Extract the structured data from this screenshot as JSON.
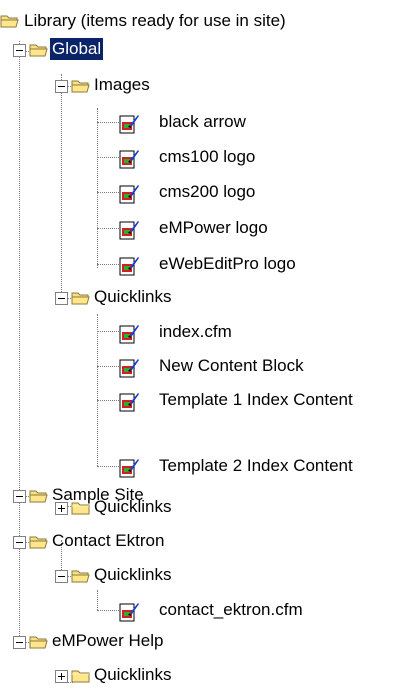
{
  "tree": {
    "root": {
      "label": "Library (items ready for use in site)",
      "icon": "open-folder-icon"
    },
    "global": {
      "label": "Global",
      "selected": true,
      "images": {
        "label": "Images",
        "items": [
          {
            "label": "black arrow",
            "icon": "content-item-icon"
          },
          {
            "label": "cms100 logo",
            "icon": "content-item-icon"
          },
          {
            "label": "cms200 logo",
            "icon": "content-item-icon"
          },
          {
            "label": "eMPower logo",
            "icon": "content-item-icon"
          },
          {
            "label": "eWebEditPro logo",
            "icon": "content-item-icon"
          }
        ]
      },
      "quicklinks": {
        "label": "Quicklinks",
        "items": [
          {
            "label": "index.cfm",
            "icon": "content-item-icon"
          },
          {
            "label": "New Content Block",
            "icon": "content-item-icon"
          },
          {
            "label": "Template 1 Index Content",
            "icon": "content-item-icon"
          },
          {
            "label": "Template 2 Index Content",
            "icon": "content-item-icon"
          }
        ]
      }
    },
    "sample_site": {
      "label": "Sample Site",
      "quicklinks": {
        "label": "Quicklinks",
        "expanded": false
      }
    },
    "contact_ektron": {
      "label": "Contact Ektron",
      "quicklinks": {
        "label": "Quicklinks",
        "items": [
          {
            "label": "contact_ektron.cfm",
            "icon": "content-item-icon"
          }
        ]
      }
    },
    "empower_help": {
      "label": "eMPower Help",
      "quicklinks": {
        "label": "Quicklinks",
        "expanded": false
      }
    }
  },
  "colors": {
    "selection_bg": "#0a246a",
    "selection_fg": "#ffffff",
    "folder_fill": "#ffe68a",
    "folder_edge": "#8c7a3a",
    "line": "#808080"
  }
}
